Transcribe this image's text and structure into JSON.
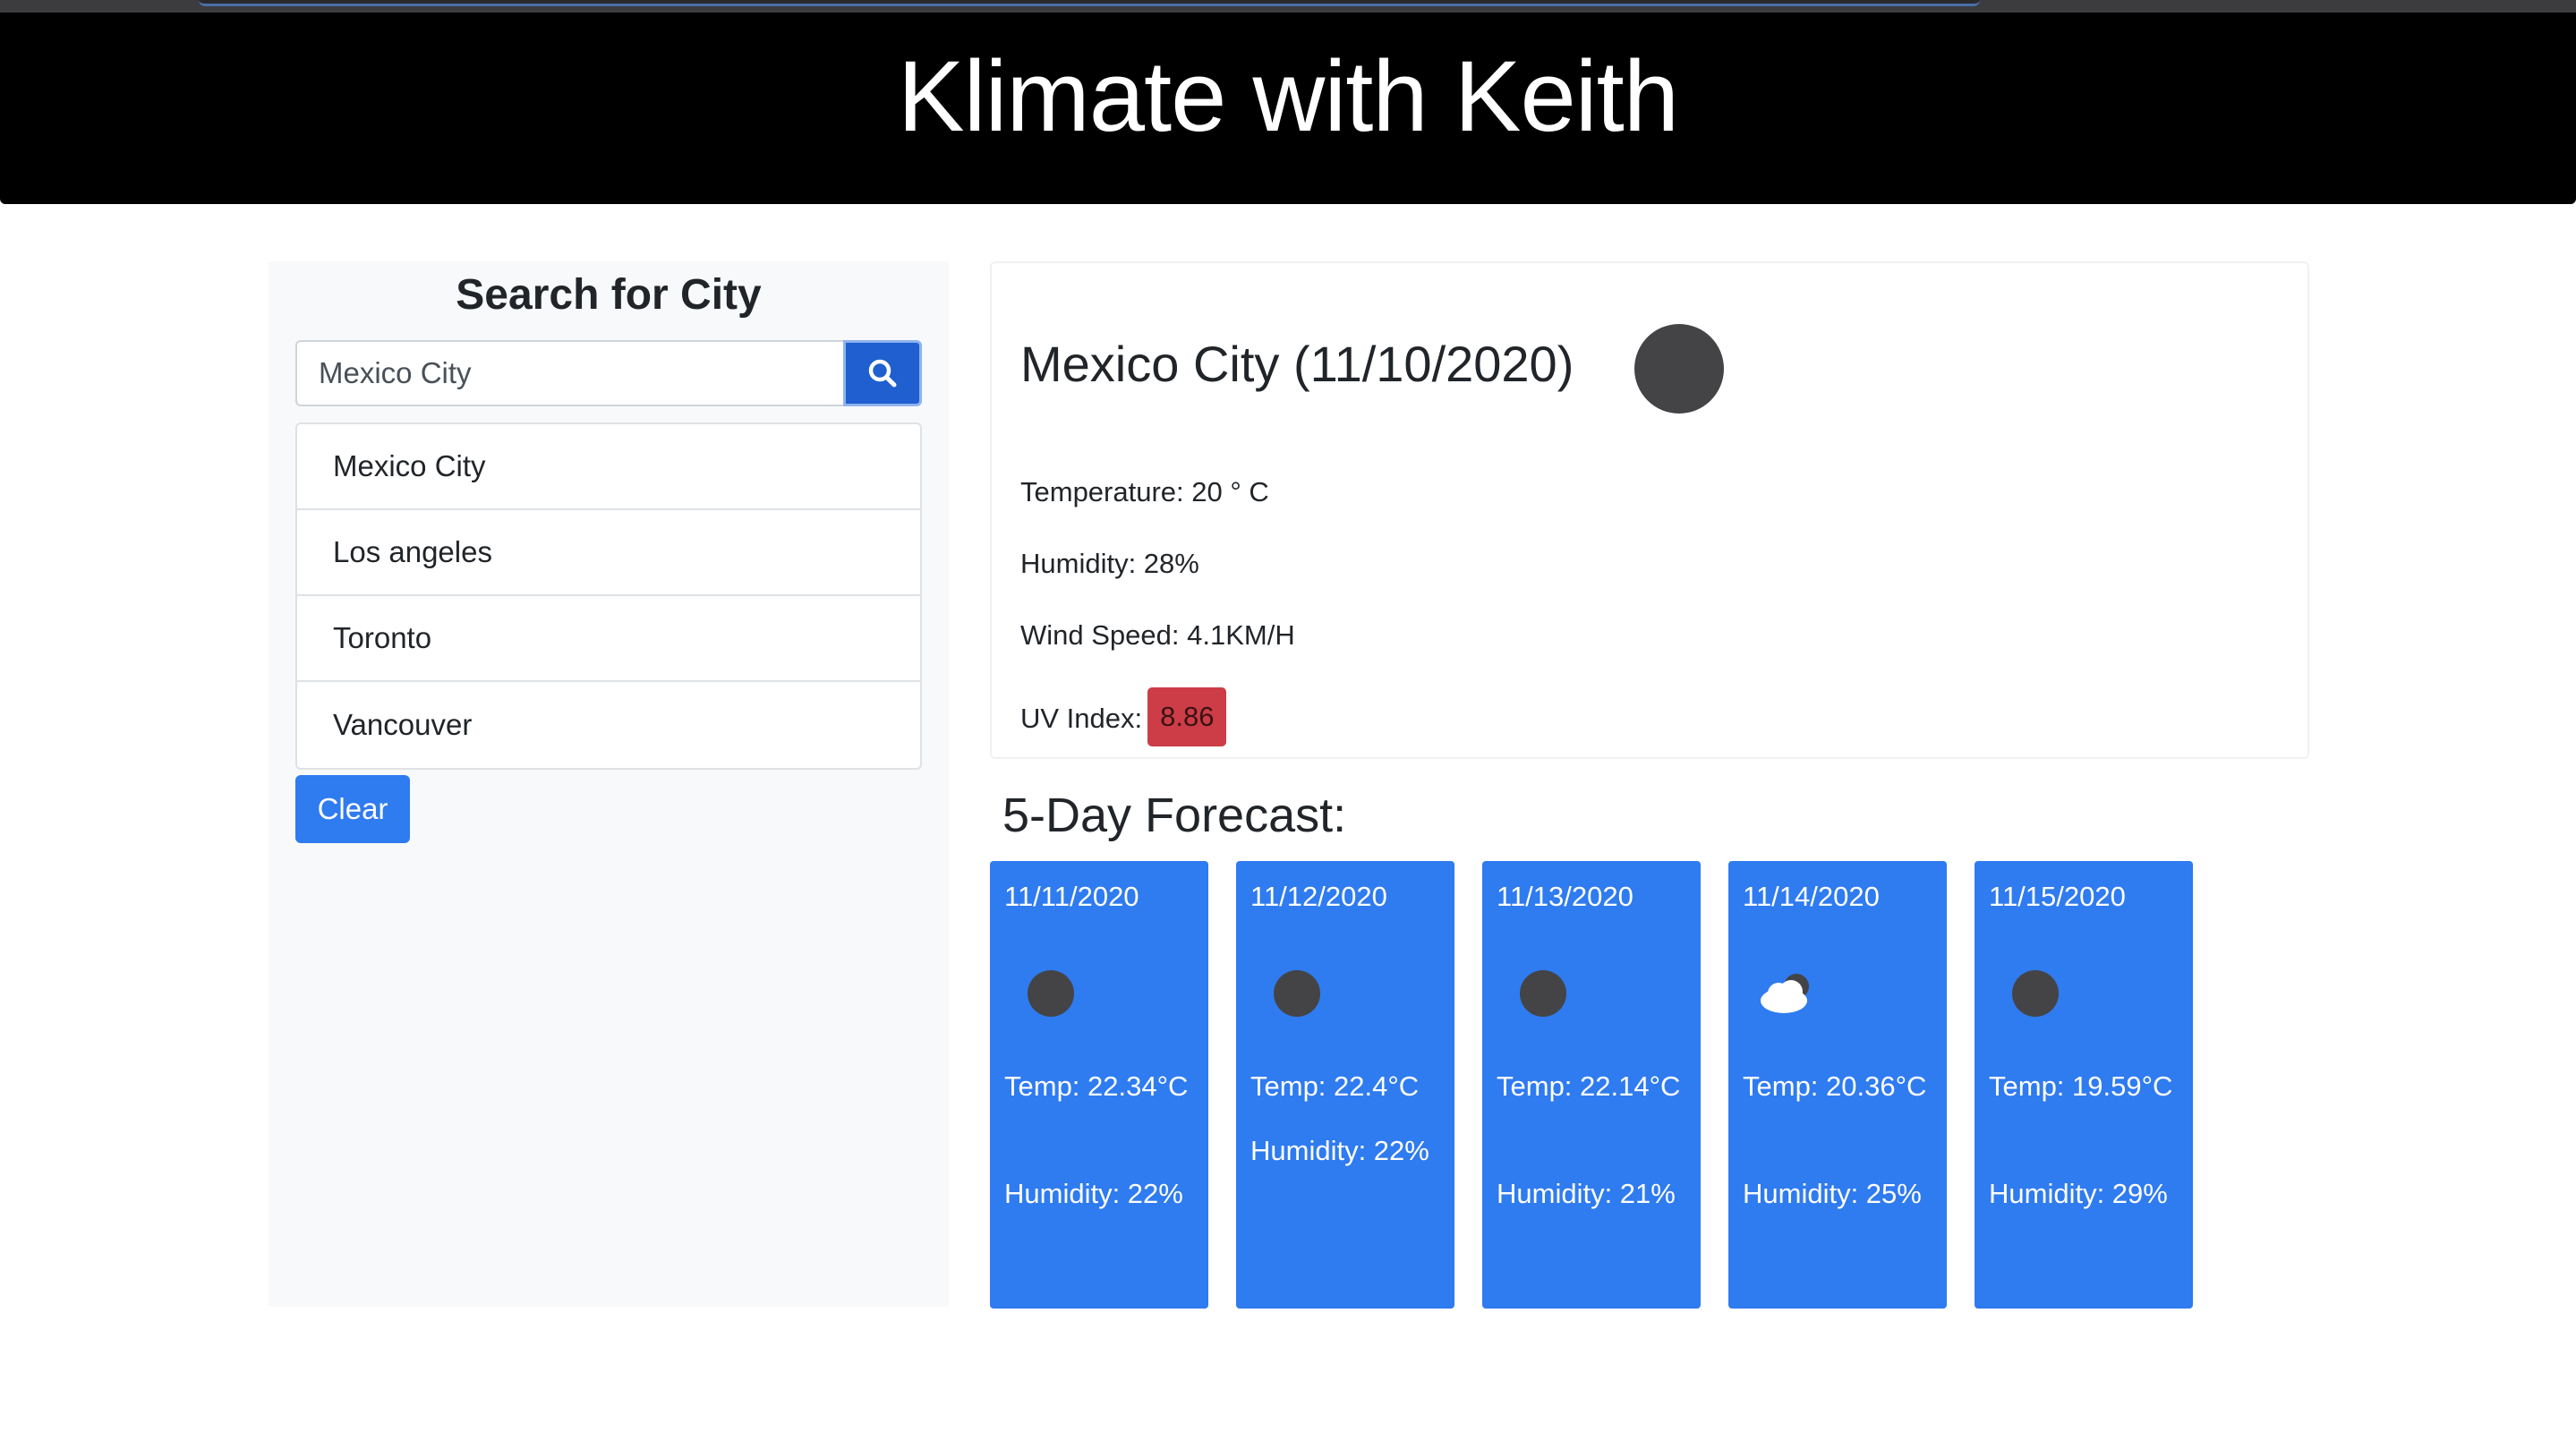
{
  "header": {
    "title": "Klimate with Keith"
  },
  "search": {
    "heading": "Search for City",
    "input_value": "Mexico City",
    "button_icon": "search-icon",
    "history": [
      "Mexico City",
      "Los angeles",
      "Toronto",
      "Vancouver"
    ],
    "clear_label": "Clear"
  },
  "current": {
    "title": "Mexico City (11/10/2020)",
    "temperature": "Temperature: 20 ° C",
    "humidity": "Humidity: 28%",
    "wind": "Wind Speed: 4.1KM/H",
    "uv_label": "UV Index:",
    "uv_value": "8.86",
    "uv_color": "#cc3d47",
    "icon": "weather-icon"
  },
  "forecast": {
    "title": "5-Day Forecast:",
    "days": [
      {
        "date": "11/11/2020",
        "icon": "weather-icon",
        "temp": "Temp: 22.34°C",
        "humidity": "Humidity: 22%"
      },
      {
        "date": "11/12/2020",
        "icon": "weather-icon",
        "temp": "Temp: 22.4°C",
        "humidity": "Humidity: 22%"
      },
      {
        "date": "11/13/2020",
        "icon": "weather-icon",
        "temp": "Temp: 22.14°C",
        "humidity": "Humidity: 21%"
      },
      {
        "date": "11/14/2020",
        "icon": "cloud-icon",
        "temp": "Temp: 20.36°C",
        "humidity": "Humidity: 25%"
      },
      {
        "date": "11/15/2020",
        "icon": "weather-icon",
        "temp": "Temp: 19.59°C",
        "humidity": "Humidity: 29%"
      }
    ]
  },
  "colors": {
    "header_bg": "#000000",
    "accent": "#2f7bf0",
    "search_button": "#1f5fcf",
    "sidebar_bg": "#f8f9fa"
  }
}
